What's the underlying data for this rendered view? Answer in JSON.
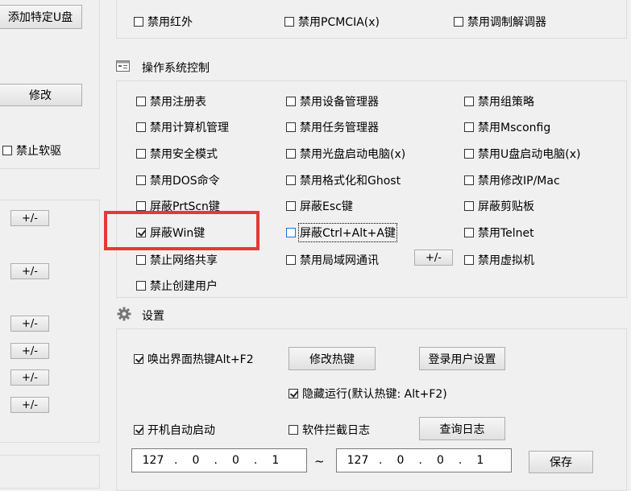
{
  "left_panel": {
    "add_usb_button": "添加特定U盘",
    "modify_button": "修改",
    "forbid_softdrive": "禁止软驱",
    "plusminus": [
      "+/-",
      "+/-",
      "+/-",
      "+/-",
      "+/-",
      "+/-"
    ]
  },
  "top_row": {
    "items": [
      {
        "label": "禁用红外",
        "checked": false
      },
      {
        "label": "禁用PCMCIA(x)",
        "checked": false
      },
      {
        "label": "禁用调制解调器",
        "checked": false
      }
    ]
  },
  "os_control": {
    "title": "操作系统控制",
    "col1": [
      {
        "label": "禁用注册表",
        "checked": false
      },
      {
        "label": "禁用计算机管理",
        "checked": false
      },
      {
        "label": "禁用安全模式",
        "checked": false
      },
      {
        "label": "禁用DOS命令",
        "checked": false
      },
      {
        "label": "屏蔽PrtScn键",
        "checked": false
      },
      {
        "label": "屏蔽Win键",
        "checked": true
      },
      {
        "label": "禁止网络共享",
        "checked": false
      },
      {
        "label": "禁止创建用户",
        "checked": false
      }
    ],
    "col2": [
      {
        "label": "禁用设备管理器",
        "checked": false
      },
      {
        "label": "禁用任务管理器",
        "checked": false
      },
      {
        "label": "禁用光盘启动电脑(x)",
        "checked": false
      },
      {
        "label": "禁用格式化和Ghost",
        "checked": false
      },
      {
        "label": "屏蔽Esc键",
        "checked": false
      },
      {
        "label": "屏蔽Ctrl+Alt+A键",
        "checked": false
      },
      {
        "label": "禁用局域网通讯",
        "checked": false
      }
    ],
    "lan_plusminus": "+/-",
    "col3": [
      {
        "label": "禁用组策略",
        "checked": false
      },
      {
        "label": "禁用Msconfig",
        "checked": false
      },
      {
        "label": "禁用U盘启动电脑(x)",
        "checked": false
      },
      {
        "label": "禁用修改IP/Mac",
        "checked": false
      },
      {
        "label": "屏蔽剪贴板",
        "checked": false
      },
      {
        "label": "禁用Telnet",
        "checked": false
      },
      {
        "label": "禁用虚拟机",
        "checked": false
      }
    ]
  },
  "settings": {
    "title": "设置",
    "hotkey_checkbox": "唤出界面热键Alt+F2",
    "modify_hotkey_button": "修改热键",
    "login_user_settings_button": "登录用户设置",
    "hidden_run_checkbox": "隐藏运行(默认热键: Alt+F2)",
    "autostart_checkbox": "开机自动启动",
    "intercept_log_checkbox": "软件拦截日志",
    "query_log_button": "查询日志",
    "ip_from": [
      "127",
      "0",
      "0",
      "1"
    ],
    "ip_separator": "~",
    "ip_to": [
      "127",
      "0",
      "0",
      "1"
    ],
    "save_button": "保存"
  },
  "colors": {
    "highlight_rect": "#e53935",
    "background": "#f0f0f0"
  }
}
